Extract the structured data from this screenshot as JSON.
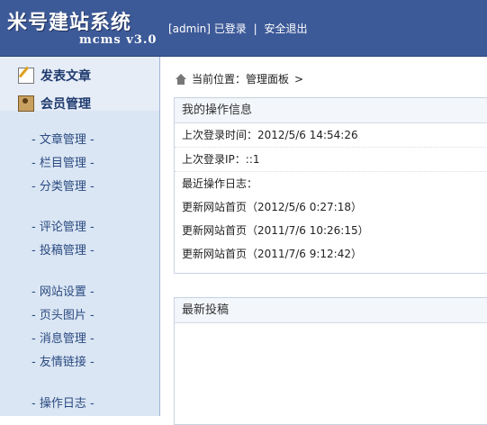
{
  "header": {
    "title": "米号建站系统",
    "subtitle": "mcms v3.0",
    "user": "[admin]",
    "logged_in": "已登录",
    "separator": "|",
    "logout": "安全退出"
  },
  "sidebar": {
    "top_items": [
      {
        "label": "发表文章",
        "icon": "edit-icon"
      },
      {
        "label": "会员管理",
        "icon": "member-icon"
      }
    ],
    "groups": [
      [
        "- 文章管理 -",
        "- 栏目管理 -",
        "- 分类管理 -"
      ],
      [
        "- 评论管理 -",
        "- 投稿管理 -"
      ],
      [
        "- 网站设置 -",
        "- 页头图片 -",
        "- 消息管理 -",
        "- 友情链接 -"
      ],
      [
        "- 操作日志 -"
      ]
    ]
  },
  "breadcrumb": {
    "prefix": "当前位置：",
    "current": "管理面板",
    "arrow": ">"
  },
  "info_panel": {
    "title": "我的操作信息",
    "last_login_time": "上次登录时间：2012/5/6 14:54:26",
    "last_login_ip": "上次登录IP：::1",
    "recent_log_title": "最近操作日志：",
    "logs": [
      "更新网站首页（2012/5/6 0:27:18）",
      "更新网站首页（2011/7/6 10:26:15）",
      "更新网站首页（2011/7/6 9:12:42）"
    ]
  },
  "submissions_panel": {
    "title": "最新投稿"
  }
}
